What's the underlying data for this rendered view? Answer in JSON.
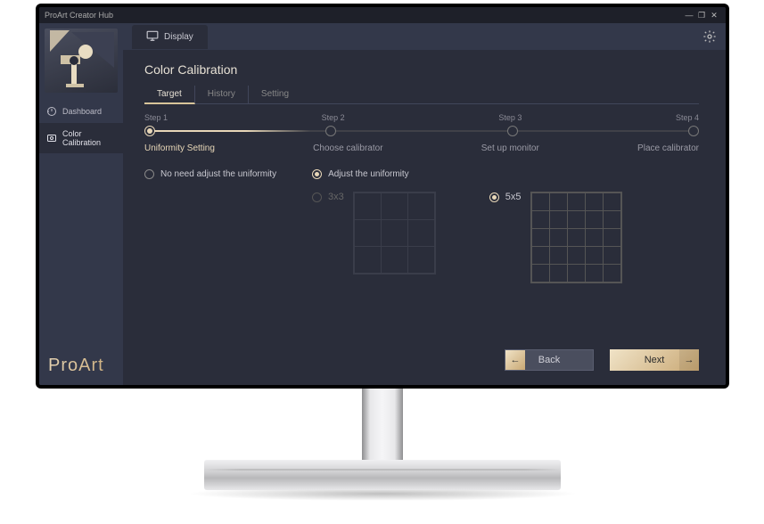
{
  "window": {
    "title": "ProArt Creator Hub"
  },
  "tabbar": {
    "display": "Display"
  },
  "sidebar": {
    "dashboard": "Dashboard",
    "calibration": "Color Calibration",
    "brand": "ProArt"
  },
  "page": {
    "title": "Color Calibration",
    "subtabs": {
      "target": "Target",
      "history": "History",
      "setting": "Setting"
    }
  },
  "steps": {
    "labels": {
      "s1": "Step 1",
      "s2": "Step 2",
      "s3": "Step 3",
      "s4": "Step 4"
    },
    "captions": {
      "c1": "Uniformity Setting",
      "c2": "Choose calibrator",
      "c3": "Set up monitor",
      "c4": "Place calibrator"
    }
  },
  "options": {
    "no_adjust": "No need adjust the uniformity",
    "adjust": "Adjust the uniformity",
    "g33": "3x3",
    "g55": "5x5"
  },
  "buttons": {
    "back": "Back",
    "next": "Next"
  }
}
